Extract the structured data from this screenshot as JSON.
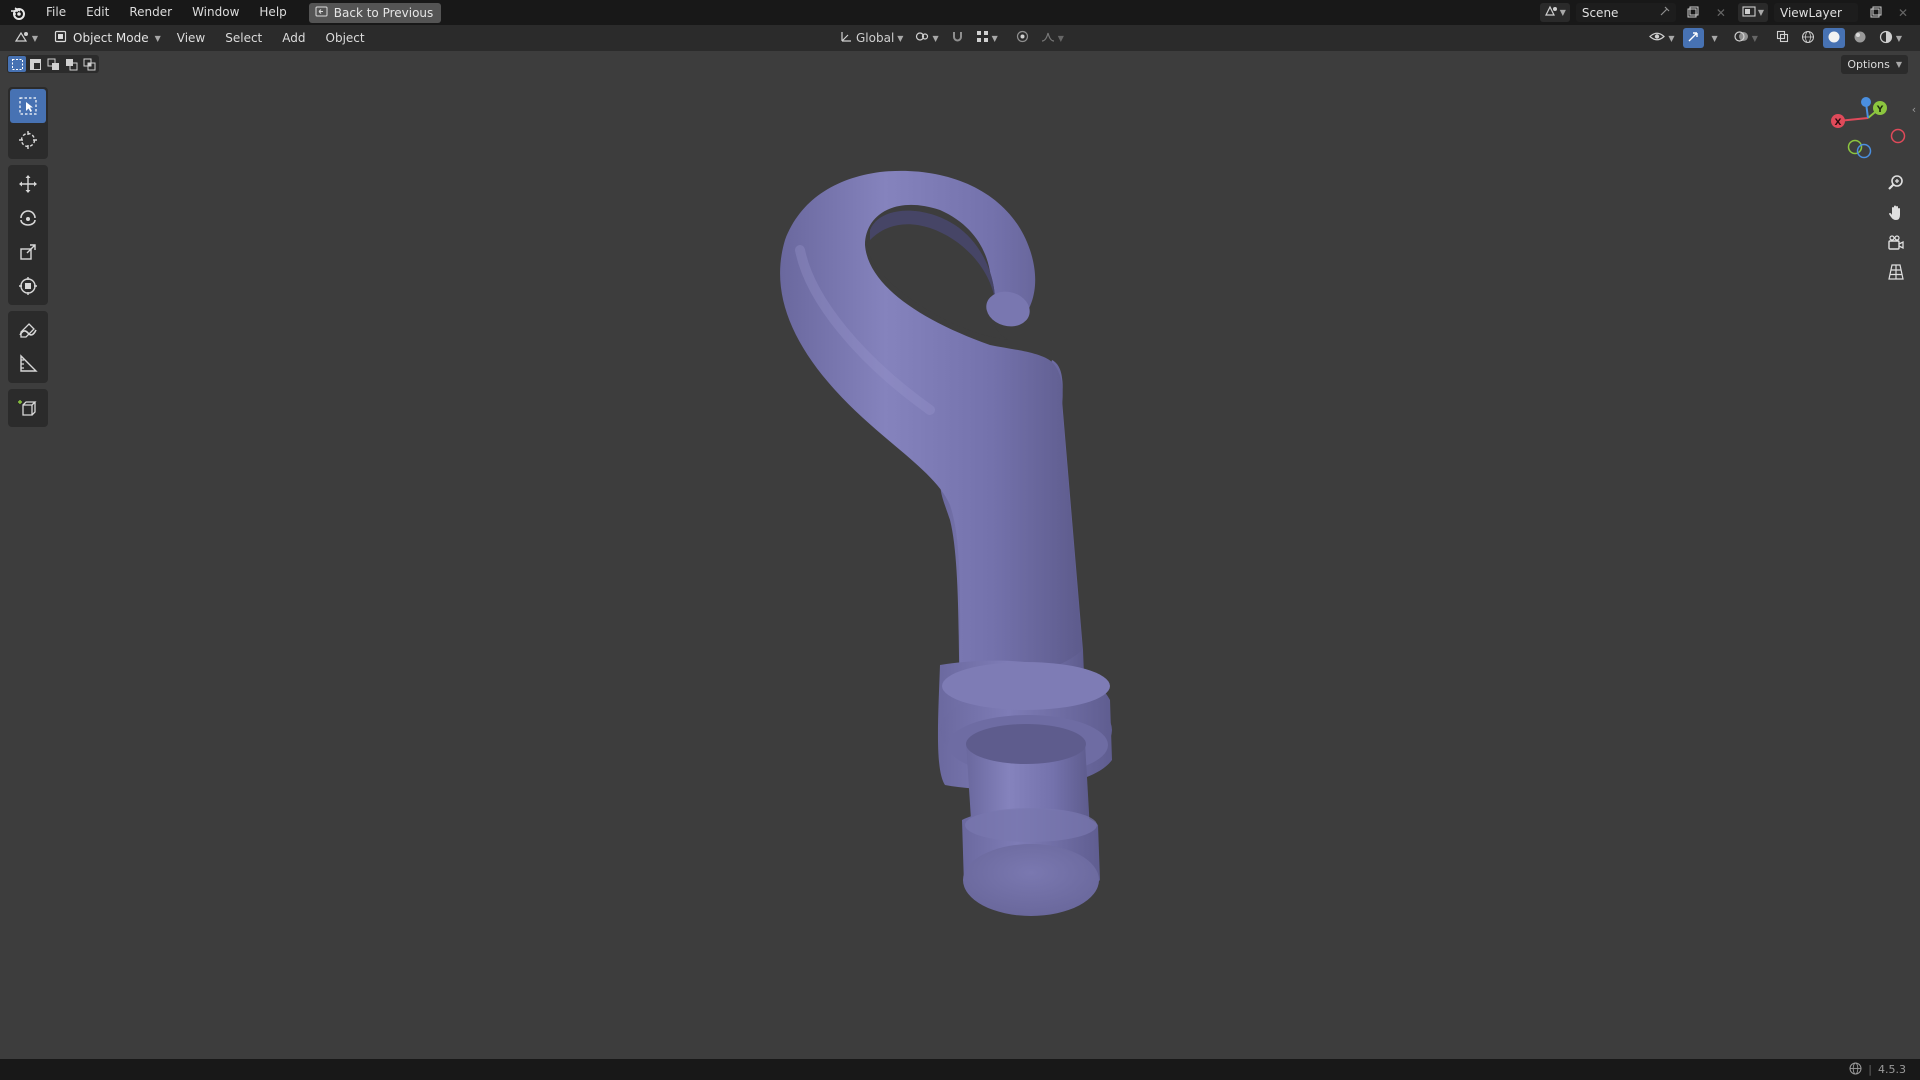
{
  "menubar": {
    "items": [
      "File",
      "Edit",
      "Render",
      "Window",
      "Help"
    ],
    "back_button": "Back to Previous",
    "scene_label": "Scene",
    "viewlayer_label": "ViewLayer"
  },
  "header": {
    "mode": "Object Mode",
    "menus": [
      "View",
      "Select",
      "Add",
      "Object"
    ],
    "transform_orientation": "Global"
  },
  "options_label": "Options",
  "toolbar": {
    "tools": [
      "select-box-icon",
      "cursor-icon",
      "move-icon",
      "rotate-icon",
      "scale-icon",
      "transform-icon",
      "annotate-icon",
      "measure-icon",
      "add-cube-icon"
    ],
    "active_tool": "select-box-icon"
  },
  "gizmo": {
    "x_label": "X",
    "y_label": "Y",
    "z_label": "Z"
  },
  "status": {
    "version": "4.5.3"
  },
  "colors": {
    "accent": "#4772b3",
    "model": "#7a78b0",
    "background": "#3d3d3d",
    "axis_x": "#e04a5a",
    "axis_y": "#8cc63f",
    "axis_z": "#4a8fe0"
  }
}
